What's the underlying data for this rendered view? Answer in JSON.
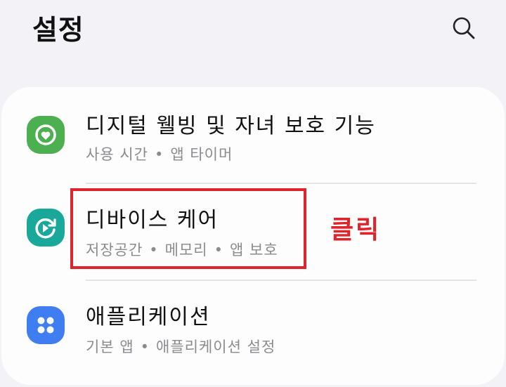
{
  "header": {
    "title": "설정",
    "search_icon": "search-icon"
  },
  "colors": {
    "background": "#f3f2f7",
    "card": "#fdfdfe",
    "digital_wellbeing_icon": "#4caf50",
    "device_care_icon": "#1aa89a",
    "apps_icon": "#3f7ef0",
    "annotation": "#e0242b"
  },
  "settings_list": [
    {
      "title": "디지털 웰빙 및 자녀 보호 기능",
      "subtitle": [
        "사용 시간",
        "앱 타이머"
      ],
      "icon": "digital-wellbeing-icon"
    },
    {
      "title": "디바이스 케어",
      "subtitle": [
        "저장공간",
        "메모리",
        "앱 보호"
      ],
      "icon": "device-care-icon"
    },
    {
      "title": "애플리케이션",
      "subtitle": [
        "기본 앱",
        "애플리케이션 설정"
      ],
      "icon": "apps-icon"
    }
  ],
  "annotation": {
    "label": "클릭"
  }
}
